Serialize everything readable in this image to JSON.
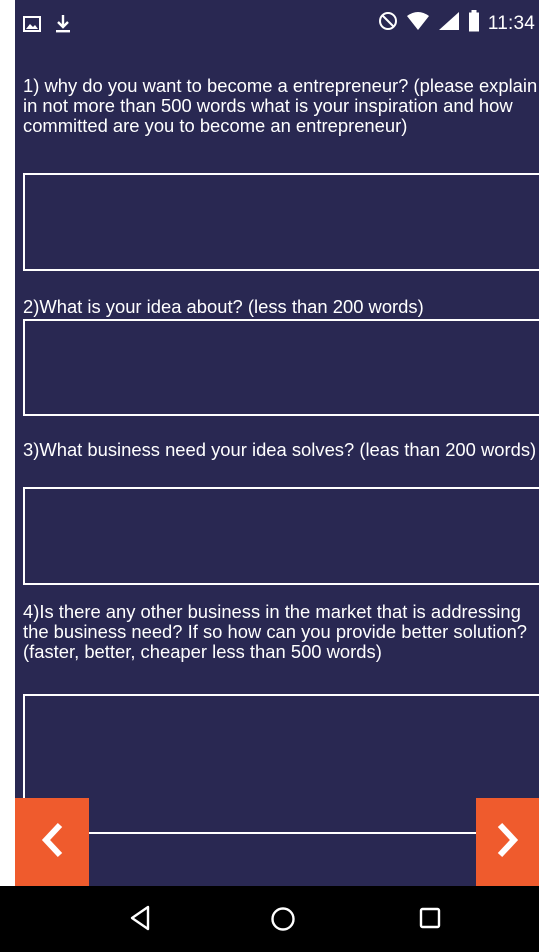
{
  "status_bar": {
    "time": "11:34",
    "left_icons": [
      "image-icon",
      "download-icon"
    ],
    "right_icons": [
      "do-not-disturb-icon",
      "wifi-icon",
      "signal-icon",
      "battery-icon"
    ]
  },
  "questions": [
    {
      "label": "1) why do you want to become a entrepreneur? (please explain in not more than 500 words what is your inspiration and how committed are you to become an entrepreneur)",
      "answer": ""
    },
    {
      "label": "2)What is your idea about? (less than 200 words)",
      "answer": ""
    },
    {
      "label": "3)What business need your idea solves? (leas than 200 words)",
      "answer": ""
    },
    {
      "label": "4)Is there any other business in the market that is addressing the business need? If so how can you provide better solution? (faster, better, cheaper less than 500 words)",
      "answer": ""
    }
  ],
  "navigation": {
    "prev_icon": "chevron-left-icon",
    "next_icon": "chevron-right-icon"
  },
  "system_nav": [
    "back-icon",
    "home-icon",
    "recents-icon"
  ],
  "colors": {
    "background": "#292852",
    "accent": "#ef5b2d",
    "text": "#ffffff",
    "nav_bar": "#000000"
  }
}
